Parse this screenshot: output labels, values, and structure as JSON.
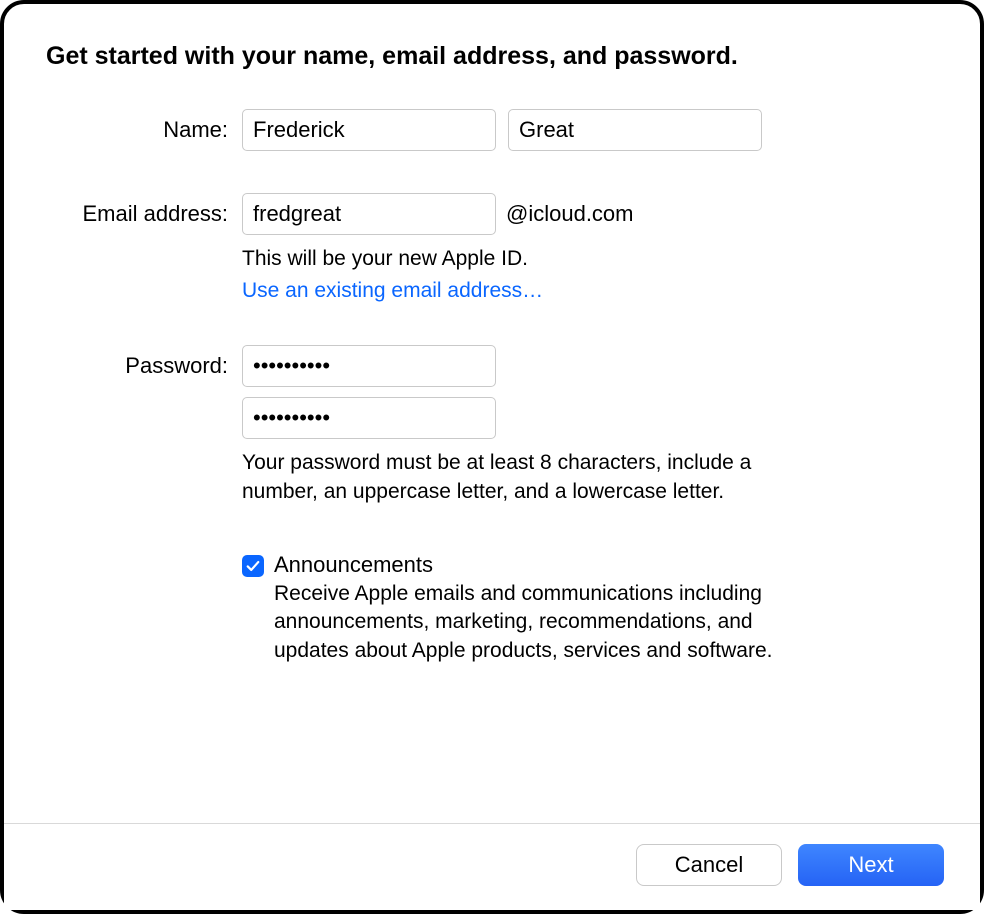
{
  "heading": "Get started with your name, email address, and password.",
  "name": {
    "label": "Name:",
    "first_value": "Frederick",
    "last_value": "Great"
  },
  "email": {
    "label": "Email address:",
    "value": "fredgreat",
    "suffix": "@icloud.com",
    "hint": "This will be your new Apple ID.",
    "link": "Use an existing email address…"
  },
  "password": {
    "label": "Password:",
    "value": "••••••••••",
    "confirm_value": "••••••••••",
    "hint": "Your password must be at least 8 characters, include a number, an uppercase letter, and a lowercase letter."
  },
  "announcements": {
    "checked": true,
    "title": "Announcements",
    "desc": "Receive Apple emails and communications including announcements, marketing, recommendations, and updates about Apple products, services and software."
  },
  "footer": {
    "cancel": "Cancel",
    "next": "Next"
  }
}
